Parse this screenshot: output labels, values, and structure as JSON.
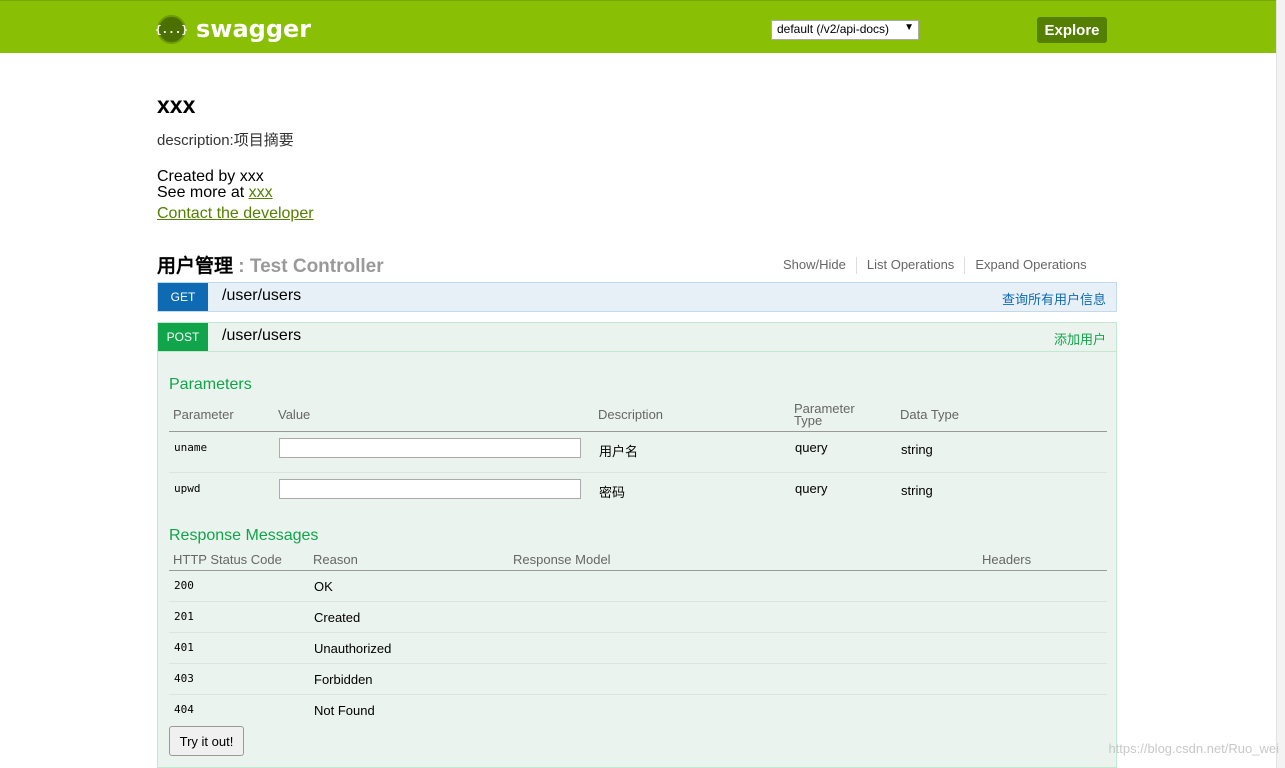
{
  "header": {
    "logo_text": "swagger",
    "logo_icon_text": "{...}",
    "spec_selected": "default (/v2/api-docs)",
    "explore_label": "Explore"
  },
  "info": {
    "title": "xxx",
    "description": "description:项目摘要",
    "created_by": "Created by xxx",
    "see_more_prefix": "See more at ",
    "see_more_link": "xxx",
    "contact_link": "Contact the developer"
  },
  "resource": {
    "name": "用户管理",
    "separator": " : ",
    "description": "Test Controller",
    "links": [
      "Show/Hide",
      "List Operations",
      "Expand Operations"
    ]
  },
  "operations": [
    {
      "method": "GET",
      "path": "/user/users",
      "summary": "查询所有用户信息"
    },
    {
      "method": "POST",
      "path": "/user/users",
      "summary": "添加用户"
    }
  ],
  "parameters": {
    "title": "Parameters",
    "headers": [
      "Parameter",
      "Value",
      "Description",
      "Parameter Type",
      "Data Type"
    ],
    "header_type_line1": "Parameter",
    "header_type_line2": "Type",
    "rows": [
      {
        "name": "uname",
        "value": "",
        "description": "用户名",
        "param_type": "query",
        "data_type": "string"
      },
      {
        "name": "upwd",
        "value": "",
        "description": "密码",
        "param_type": "query",
        "data_type": "string"
      }
    ]
  },
  "responses": {
    "title": "Response Messages",
    "headers": [
      "HTTP Status Code",
      "Reason",
      "Response Model",
      "Headers"
    ],
    "rows": [
      {
        "code": "200",
        "reason": "OK"
      },
      {
        "code": "201",
        "reason": "Created"
      },
      {
        "code": "401",
        "reason": "Unauthorized"
      },
      {
        "code": "403",
        "reason": "Forbidden"
      },
      {
        "code": "404",
        "reason": "Not Found"
      }
    ]
  },
  "try_button": "Try it out!",
  "watermark": "https://blog.csdn.net/Ruo_wei",
  "colors": {
    "header_bg": "#89bf04",
    "get": "#0f6ab4",
    "post": "#10a54a",
    "link": "#547f00"
  }
}
